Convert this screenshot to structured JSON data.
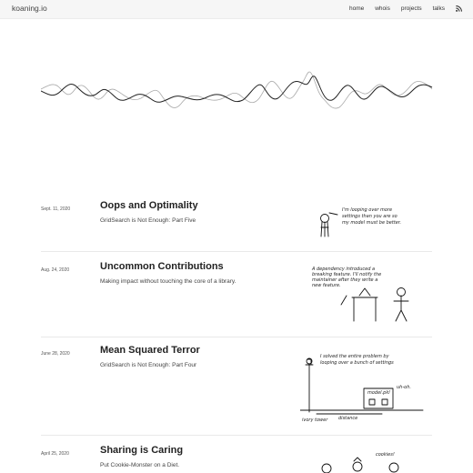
{
  "site": {
    "brand": "koaning.io"
  },
  "nav": {
    "items": [
      "home",
      "whois",
      "projects",
      "talks"
    ],
    "rss_icon": "rss-icon"
  },
  "hero": {
    "description": ""
  },
  "posts": [
    {
      "date": "Sept. 11, 2020",
      "title": "Oops and Optimality",
      "subtitle": "GridSearch is Not Enough: Part Five",
      "sketch_text": [
        "I'm looping over more",
        "settings than you are so",
        "my model must be better."
      ]
    },
    {
      "date": "Aug. 24, 2020",
      "title": "Uncommon Contributions",
      "subtitle": "Making impact without touching the core of a library.",
      "sketch_text": [
        "A dependency introduced a",
        "breaking feature. I'll notify the",
        "maintainer after they write a",
        "new feature."
      ]
    },
    {
      "date": "June 28, 2020",
      "title": "Mean Squared Terror",
      "subtitle": "GridSearch is Not Enough: Part Four",
      "sketch_text": [
        "I solved the entire problem by",
        "looping over a bunch of settings",
        "uh-oh.",
        "ivory tower",
        "distance",
        "model.pkl"
      ]
    },
    {
      "date": "April 25, 2020",
      "title": "Sharing is Caring",
      "subtitle": "Put Cookie-Monster on a Diet.",
      "sketch_text": [
        "cookies!"
      ]
    }
  ]
}
